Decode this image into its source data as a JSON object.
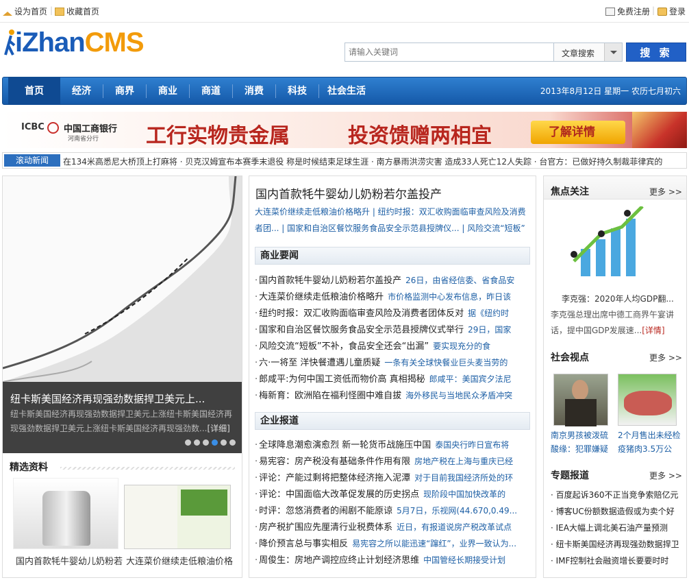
{
  "topbar": {
    "set_home": "设为首页",
    "bookmark": "收藏首页",
    "register": "免费注册",
    "login": "登录"
  },
  "logo": {
    "part1": "iZhan",
    "part2": "CMS"
  },
  "search": {
    "placeholder": "请输入关键词",
    "type": "文章搜索",
    "button": "搜 索"
  },
  "nav": {
    "items": [
      "首页",
      "经济",
      "商界",
      "商业",
      "商道",
      "消费",
      "科技",
      "社会生活"
    ],
    "date": "2013年8月12日 星期一 农历七月初六"
  },
  "banner": {
    "bank_en": "ICBC",
    "bank_cn": "中国工商银行",
    "branch": "河南省分行",
    "slogan1": "工行实物贵金属",
    "slogan2": "投资馈赠两相宜",
    "cta": "了解详情"
  },
  "ticker": {
    "label": "滚动新闻",
    "text": "在134米高悉尼大桥顶上打麻将  · 贝克汉姆宣布本赛季末退役 称是时候结束足球生涯  · 南方暴雨洪涝灾害 造成33人死亡12人失踪  · 台官方：已做好持久制裁菲律宾的"
  },
  "slide": {
    "title": "纽卡斯美国经济再现强劲数据捍卫美元上...",
    "desc": "纽卡斯美国经济再现强劲数据捍卫美元上涨纽卡斯美国经济再现强劲数据捍卫美元上涨纽卡斯美国经济再现强劲数...",
    "detail": "[详细]"
  },
  "selected": {
    "title": "精选资料",
    "items": [
      "国内首款牦牛婴幼儿奶粉若",
      "大连菜价继续走低粮油价格"
    ]
  },
  "headline": {
    "title": "国内首款牦牛婴幼儿奶粉若尔盖投产",
    "links_line1": "大连菜价继续走低粮油价格略升 | 纽约时报：双汇收购面临审查风险及消费",
    "links_line2": "者团... | 国家和自治区餐饮服务食品安全示范县授牌仪... | 风险交流“短板”"
  },
  "business": {
    "title": "商业要闻",
    "rows": [
      {
        "t": "国内首款牦牛婴幼儿奶粉若尔盖投产",
        "d": "26日，由省经信委、省食品安"
      },
      {
        "t": "大连菜价继续走低粮油价格略升",
        "d": "市价格监测中心发布信息，昨日该"
      },
      {
        "t": "纽约时报：双汇收购面临审查风险及消费者团体反对",
        "d": "据《纽约时"
      },
      {
        "t": "国家和自治区餐饮服务食品安全示范县授牌仪式举行",
        "d": "29日，国家"
      },
      {
        "t": "风险交流“短板”不补，食品安全还会“出漏”",
        "d": "要实现充分的食"
      },
      {
        "t": "六·一将至 洋快餐遭遇儿童质疑",
        "d": "一条有关全球快餐业巨头麦当劳的"
      },
      {
        "t": "郎咸平:为何中国工资低而物价高 真相揭秘",
        "d": "郎咸平：美国宾夕法尼"
      },
      {
        "t": "梅新育：欧洲陷在福利怪圈中难自拔",
        "d": "海外移民与当地民众矛盾冲突"
      }
    ]
  },
  "enterprise": {
    "title": "企业报道",
    "rows": [
      {
        "t": "全球降息潮愈演愈烈 新一轮货币战施压中国",
        "d": "泰国央行昨日宣布将"
      },
      {
        "t": "易宪容：房产税没有基础条件作用有限",
        "d": "房地产税在上海与重庆已经"
      },
      {
        "t": "评论：产能过剩将把整体经济拖入泥潭",
        "d": "对于目前我国经济所处的环"
      },
      {
        "t": "评论：中国面临大改革促发展的历史拐点",
        "d": "现阶段中国加快改革的"
      },
      {
        "t": "时评：忽悠消费者的闹剧不能原谅",
        "d": "5月7日，乐视网(44.670,0.49..."
      },
      {
        "t": "房产税扩围应先厘清行业税费体系",
        "d": "近日，有报道说房产税改革试点"
      },
      {
        "t": "降价预言总与事实相反",
        "d": "易宪容之所以能迅速“蹿红”，业界一致认为..."
      },
      {
        "t": "周俊生：房地产调控应终止计划经济思维",
        "d": "中国管经长期接受计划"
      }
    ]
  },
  "focus": {
    "title": "焦点关注",
    "more": "更多 >>",
    "caption": "李克强：2020年人均GDP翻...",
    "desc": "李克强总理出席中德工商界午宴讲话，提中国GDP发展速...",
    "detail": "[详情]"
  },
  "opinion": {
    "title": "社会视点",
    "more": "更多 >>",
    "items": [
      "南京男孩被泼硫酸缘：犯罪嫌疑",
      "2个月售出未经检疫猪肉3.5万公"
    ]
  },
  "special": {
    "title": "专题报道",
    "more": "更多 >>",
    "items": [
      "百度起诉360不正当竞争索赔亿元",
      "博客UC份额数据造假或为卖个好",
      "IEA大幅上调北美石油产量预测",
      "纽卡斯美国经济再现强劲数据捍卫",
      "IMF控制社会融资增长要要时时"
    ]
  },
  "colors": {
    "nav": "#1f68b9",
    "accent_blue": "#2160c6",
    "link": "#1d5fa5",
    "banner_red": "#c9302c"
  }
}
